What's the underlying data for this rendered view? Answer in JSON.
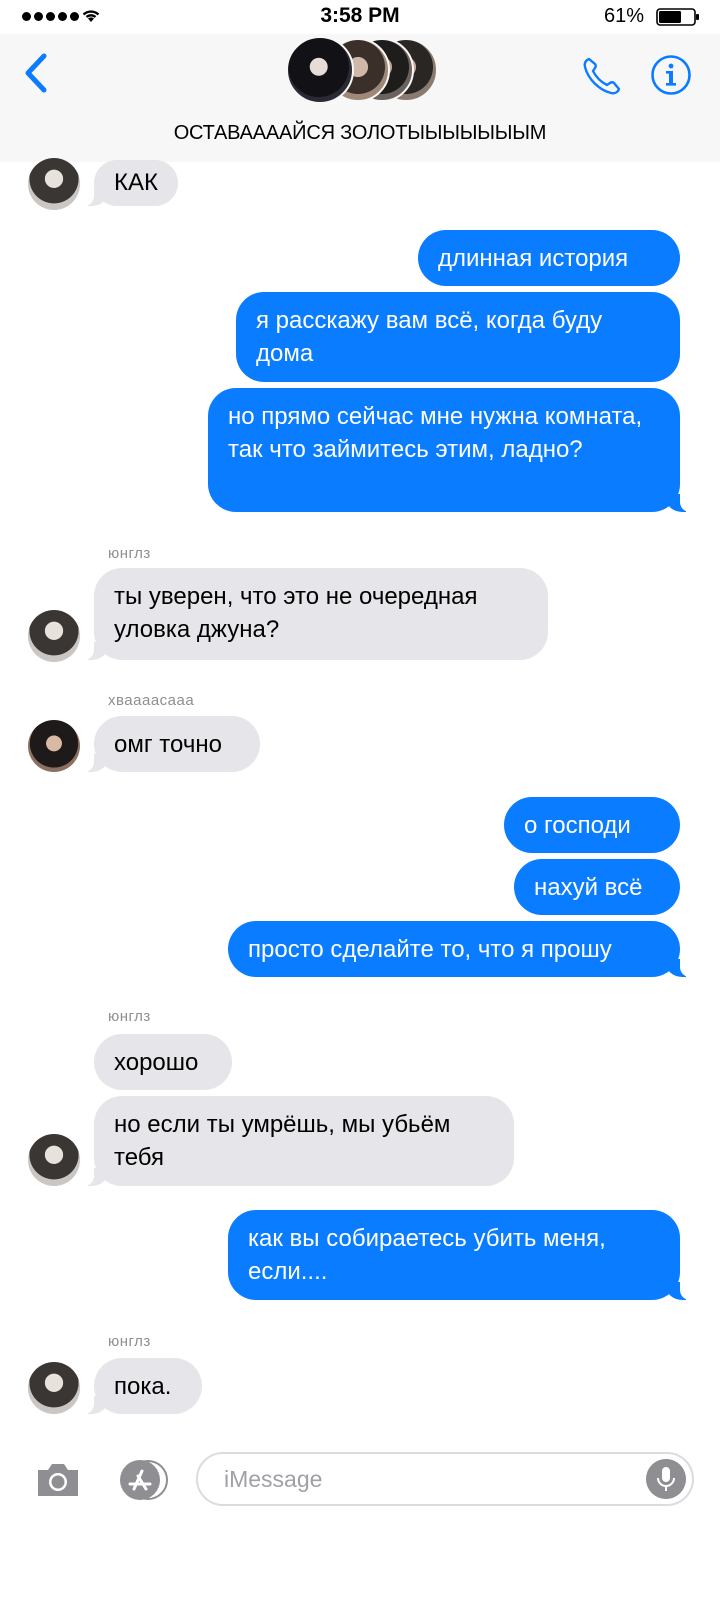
{
  "status": {
    "time": "3:58 PM",
    "battery": "61%"
  },
  "header": {
    "title": "ОСТАВААААЙСЯ ЗОЛОТЫЫЫЫЫЫЫМ",
    "icons": {
      "back": "chevron-left-icon",
      "call": "phone-icon",
      "info": "info-icon"
    }
  },
  "thread": {
    "msg1": "КАК",
    "msg2": "длинная история",
    "msg3": "я расскажу вам всё, когда буду дома",
    "msg4": "но прямо сейчас мне нужна комната, так что займитесь этим, ладно?",
    "sender1": "юнглз",
    "msg5": "ты уверен, что это не очередная уловка джуна?",
    "sender2": "хваааасааа",
    "msg6": "омг точно",
    "msg7": "о господи",
    "msg8": "нахуй всё",
    "msg9": "просто сделайте то, что я прошу",
    "sender3": "юнглз",
    "msg10": "хорошо",
    "msg11": "но если ты умрёшь, мы убьём тебя",
    "msg12": "как вы собираетесь убить меня, если....",
    "sender4": "юнглз",
    "msg13": "пока."
  },
  "composer": {
    "placeholder": "iMessage",
    "icons": {
      "camera": "camera-icon",
      "apps": "app-store-icon",
      "mic": "microphone-icon"
    }
  },
  "colors": {
    "outgoing": "#0a7cff",
    "incoming": "#e5e5ea",
    "accent": "#0a7cff"
  }
}
